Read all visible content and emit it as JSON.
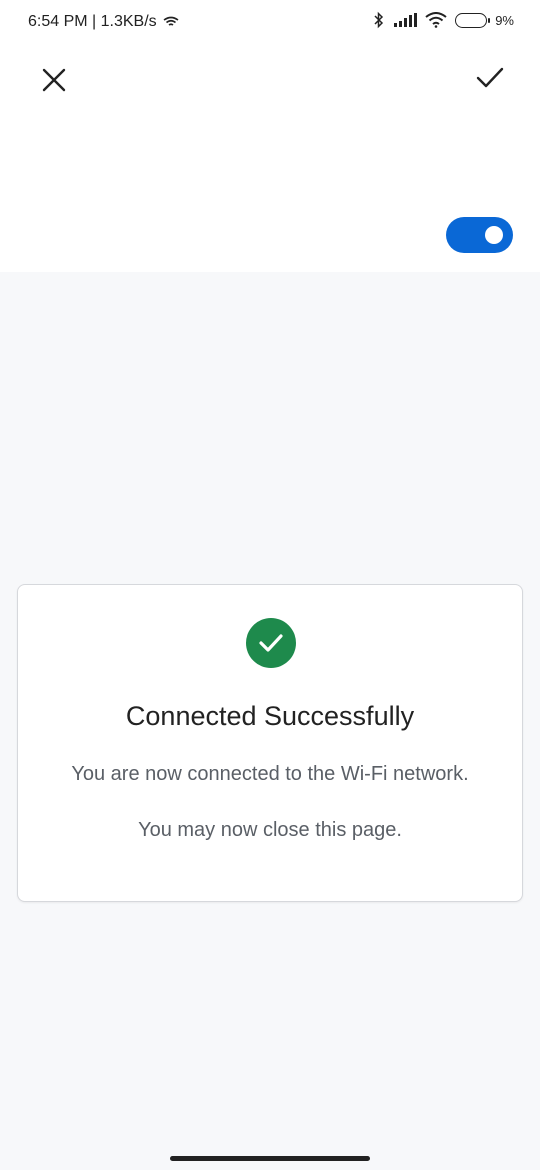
{
  "status_bar": {
    "time_network": "6:54 PM | 1.3KB/s",
    "battery_percent": "9%"
  },
  "header": {
    "close_icon": "close-icon",
    "confirm_icon": "check-icon"
  },
  "toggle": {
    "state": "on",
    "color": "#0a68d6"
  },
  "card": {
    "icon": "check-circle-icon",
    "icon_color": "#1e8a4c",
    "title": "Connected Successfully",
    "message1": "You are now connected to the Wi-Fi network.",
    "message2": "You may now close this page."
  }
}
